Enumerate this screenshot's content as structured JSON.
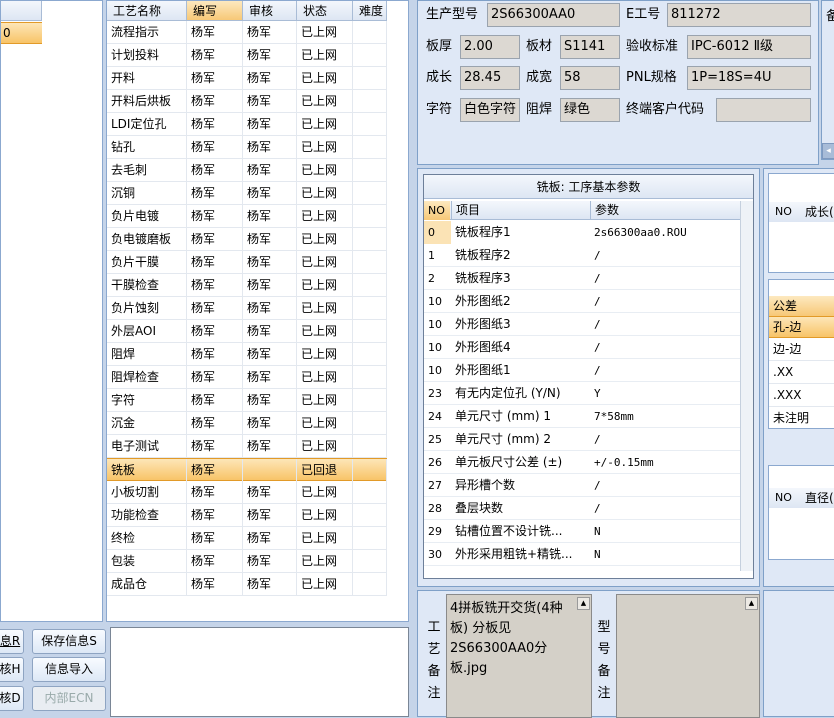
{
  "left_list": {
    "header": "",
    "selected_value": "0"
  },
  "process_table": {
    "headers": [
      "工艺名称",
      "编写",
      "审核",
      "状态",
      "难度"
    ],
    "rows": [
      [
        "流程指示",
        "杨军",
        "杨军",
        "已上网",
        ""
      ],
      [
        "计划投料",
        "杨军",
        "杨军",
        "已上网",
        ""
      ],
      [
        "开料",
        "杨军",
        "杨军",
        "已上网",
        ""
      ],
      [
        "开料后烘板",
        "杨军",
        "杨军",
        "已上网",
        ""
      ],
      [
        "LDI定位孔",
        "杨军",
        "杨军",
        "已上网",
        ""
      ],
      [
        "钻孔",
        "杨军",
        "杨军",
        "已上网",
        ""
      ],
      [
        "去毛刺",
        "杨军",
        "杨军",
        "已上网",
        ""
      ],
      [
        "沉铜",
        "杨军",
        "杨军",
        "已上网",
        ""
      ],
      [
        "负片电镀",
        "杨军",
        "杨军",
        "已上网",
        ""
      ],
      [
        "负电镀磨板",
        "杨军",
        "杨军",
        "已上网",
        ""
      ],
      [
        "负片干膜",
        "杨军",
        "杨军",
        "已上网",
        ""
      ],
      [
        "干膜检查",
        "杨军",
        "杨军",
        "已上网",
        ""
      ],
      [
        "负片蚀刻",
        "杨军",
        "杨军",
        "已上网",
        ""
      ],
      [
        "外层AOI",
        "杨军",
        "杨军",
        "已上网",
        ""
      ],
      [
        "阻焊",
        "杨军",
        "杨军",
        "已上网",
        ""
      ],
      [
        "阻焊检查",
        "杨军",
        "杨军",
        "已上网",
        ""
      ],
      [
        "字符",
        "杨军",
        "杨军",
        "已上网",
        ""
      ],
      [
        "沉金",
        "杨军",
        "杨军",
        "已上网",
        ""
      ],
      [
        "电子测试",
        "杨军",
        "杨军",
        "已上网",
        ""
      ],
      [
        "铣板",
        "杨军",
        "",
        "已回退",
        ""
      ],
      [
        "小板切割",
        "杨军",
        "杨军",
        "已上网",
        ""
      ],
      [
        "功能检查",
        "杨军",
        "杨军",
        "已上网",
        ""
      ],
      [
        "终检",
        "杨军",
        "杨军",
        "已上网",
        ""
      ],
      [
        "包装",
        "杨军",
        "杨军",
        "已上网",
        ""
      ],
      [
        "成品仓",
        "杨军",
        "杨军",
        "已上网",
        ""
      ]
    ],
    "selected_index": 19
  },
  "info": {
    "model_label": "生产型号",
    "model": "2S66300AA0",
    "eno_label": "E工号",
    "eno": "811272",
    "thick_label": "板厚",
    "thick": "2.00",
    "mat_label": "板材",
    "mat": "S1141",
    "std_label": "验收标准",
    "std": "IPC-6012 Ⅱ级",
    "len_label": "成长",
    "len": "28.45",
    "wid_label": "成宽",
    "wid": "58",
    "pnl_label": "PNL规格",
    "pnl": "1P=18S=4U",
    "char_label": "字符",
    "char": "白色字符",
    "mask_label": "阻焊",
    "mask": "绿色",
    "cust_label": "终端客户代码",
    "cust": ""
  },
  "params": {
    "title": "铣板: 工序基本参数",
    "headers": [
      "NO",
      "项目",
      "参数"
    ],
    "rows": [
      [
        "0",
        "铣板程序1",
        "2s66300aa0.ROU"
      ],
      [
        "1",
        "铣板程序2",
        "/"
      ],
      [
        "2",
        "铣板程序3",
        "/"
      ],
      [
        "10",
        "外形图纸2",
        "/"
      ],
      [
        "10",
        "外形图纸3",
        "/"
      ],
      [
        "10",
        "外形图纸4",
        "/"
      ],
      [
        "10",
        "外形图纸1",
        "/"
      ],
      [
        "23",
        "有无内定位孔 (Y/N)",
        "Y"
      ],
      [
        "24",
        "单元尺寸 (mm) 1",
        "7*58mm"
      ],
      [
        "25",
        "单元尺寸 (mm) 2",
        "/"
      ],
      [
        "26",
        "单元板尺寸公差 (±)",
        "+/-0.15mm"
      ],
      [
        "27",
        "异形槽个数",
        "/"
      ],
      [
        "28",
        "叠层块数",
        "/"
      ],
      [
        "29",
        "钻槽位置不设计铣...",
        "N"
      ],
      [
        "30",
        "外形采用粗铣+精铣...",
        "N"
      ]
    ]
  },
  "right_panel": {
    "top_label": "备",
    "grid1_headers": [
      "NO",
      "成长("
    ],
    "tol_header": "公差",
    "tol_items": [
      "孔-边",
      "边-边",
      ".XX",
      ".XXX",
      "未注明"
    ],
    "grid2_headers": [
      "NO",
      "直径("
    ]
  },
  "remarks": {
    "process_label": "工艺备注",
    "process_text": "4拼板铣开交货(4种板) 分板见2S66300AA0分板.jpg",
    "model_label": "型号备注",
    "model_text": ""
  },
  "buttons": {
    "b1": "息R",
    "save": "保存信息S",
    "b3": "核H",
    "import": "信息导入",
    "b5": "核D",
    "ecn": "内部ECN"
  }
}
